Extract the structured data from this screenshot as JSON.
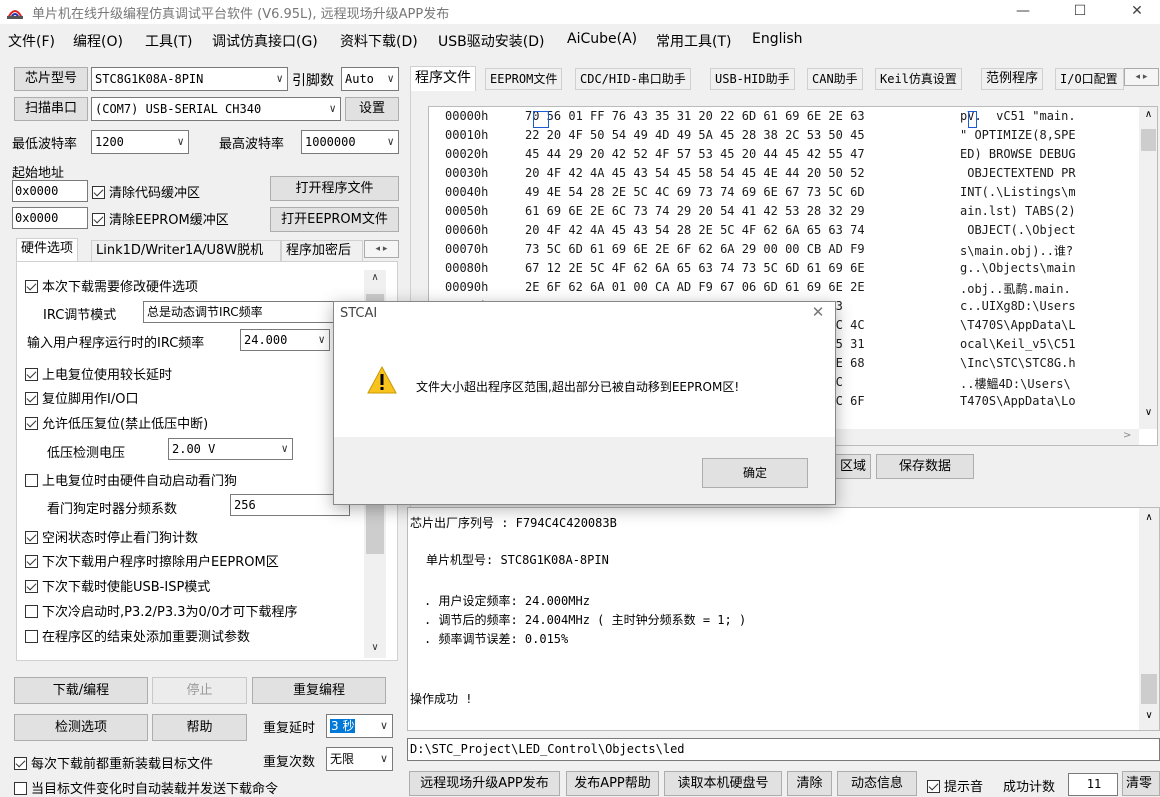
{
  "window": {
    "title": "单片机在线升级编程仿真调试平台软件 (V6.95L), 远程现场升级APP发布",
    "minimize": "—",
    "maximize": "☐",
    "close": "✕"
  },
  "menu": [
    "文件(F)",
    "编程(O)",
    "工具(T)",
    "调试仿真接口(G)",
    "资料下载(D)",
    "USB驱动安装(D)",
    "AiCube(A)",
    "常用工具(T)",
    "English"
  ],
  "left": {
    "chip_btn": "芯片型号",
    "chip_value": "STC8G1K08A-8PIN",
    "pins_label": "引脚数",
    "pins_value": "Auto",
    "scan_btn": "扫描串口",
    "port_value": "(COM7) USB-SERIAL CH340",
    "settings_btn": "设置",
    "min_baud_label": "最低波特率",
    "min_baud_value": "1200",
    "max_baud_label": "最高波特率",
    "max_baud_value": "1000000",
    "start_addr_label": "起始地址",
    "addr1": "0x0000",
    "clear_code_label": "清除代码缓冲区",
    "open_prog_btn": "打开程序文件",
    "addr2": "0x0000",
    "clear_eeprom_label": "清除EEPROM缓冲区",
    "open_eeprom_btn": "打开EEPROM文件",
    "tabs": [
      "硬件选项",
      "Link1D/Writer1A/U8W脱机",
      "程序加密后"
    ],
    "hw": {
      "opt1": "本次下载需要修改硬件选项",
      "irc_mode_label": "IRC调节模式",
      "irc_mode_value": "总是动态调节IRC频率",
      "irc_freq_label": "输入用户程序运行时的IRC频率",
      "irc_freq_value": "24.000",
      "irc_freq_unit": "M",
      "opt2": "上电复位使用较长延时",
      "opt3": "复位脚用作I/O口",
      "opt4": "允许低压复位(禁止低压中断)",
      "lv_label": "低压检测电压",
      "lv_value": "2.00 V",
      "opt5": "上电复位时由硬件自动启动看门狗",
      "wdt_label": "看门狗定时器分频系数",
      "wdt_value": "256",
      "opt6": "空闲状态时停止看门狗计数",
      "opt7": "下次下载用户程序时擦除用户EEPROM区",
      "opt8": "下次下载时使能USB-ISP模式",
      "opt9": "下次冷启动时,P3.2/P3.3为0/0才可下载程序",
      "opt10": "在程序区的结束处添加重要测试参数"
    },
    "download_btn": "下载/编程",
    "stop_btn": "停止",
    "reprogram_btn": "重复编程",
    "check_btn": "检测选项",
    "help_btn": "帮助",
    "repeat_delay_label": "重复延时",
    "repeat_delay_value": "3 秒",
    "reload_label": "每次下载前都重新装载目标文件",
    "repeat_count_label": "重复次数",
    "repeat_count_value": "无限",
    "auto_label": "当目标文件变化时自动装载并发送下载命令"
  },
  "right": {
    "tabs": [
      "程序文件",
      "EEPROM文件",
      "CDC/HID-串口助手",
      "USB-HID助手",
      "CAN助手",
      "Keil仿真设置",
      "范例程序",
      "I/O口配置"
    ],
    "hex_rows": [
      {
        "addr": "00000h",
        "bytes": "70 56 01 FF 76 43 35 31 20 22 6D 61 69 6E 2E 63",
        "ascii": "pV.  vC51 \"main."
      },
      {
        "addr": "00010h",
        "bytes": "22 20 4F 50 54 49 4D 49 5A 45 28 38 2C 53 50 45",
        "ascii": "\" OPTIMIZE(8,SPE"
      },
      {
        "addr": "00020h",
        "bytes": "45 44 29 20 42 52 4F 57 53 45 20 44 45 42 55 47",
        "ascii": "ED) BROWSE DEBUG"
      },
      {
        "addr": "00030h",
        "bytes": "20 4F 42 4A 45 43 54 45 58 54 45 4E 44 20 50 52",
        "ascii": " OBJECTEXTEND PR"
      },
      {
        "addr": "00040h",
        "bytes": "49 4E 54 28 2E 5C 4C 69 73 74 69 6E 67 73 5C 6D",
        "ascii": "INT(.\\Listings\\m"
      },
      {
        "addr": "00050h",
        "bytes": "61 69 6E 2E 6C 73 74 29 20 54 41 42 53 28 32 29",
        "ascii": "ain.lst) TABS(2)"
      },
      {
        "addr": "00060h",
        "bytes": "20 4F 42 4A 45 43 54 28 2E 5C 4F 62 6A 65 63 74",
        "ascii": " OBJECT(.\\Object"
      },
      {
        "addr": "00070h",
        "bytes": "73 5C 6D 61 69 6E 2E 6F 62 6A 29 00 00 CB AD F9",
        "ascii": "s\\main.obj)..谁?"
      },
      {
        "addr": "00080h",
        "bytes": "67 12 2E 5C 4F 62 6A 65 63 74 73 5C 6D 61 69 6E",
        "ascii": "g..\\Objects\\main"
      },
      {
        "addr": "00090h",
        "bytes": "2E 6F 62 6A 01 00 CA AD F9 67 06 6D 61 69 6E 2E",
        "ascii": ".obj..虱鹬.main."
      },
      {
        "addr": "000A0h",
        "bytes": "63 00 55 49 58 67 38 44 3A 5C 55 73 65 72 73",
        "ascii": "c..UIXg8D:\\Users"
      },
      {
        "addr": "000B0h",
        "bytes": "5C 54 34 37 30 53 5C 41 70 70 44 61 74 61 5C 4C",
        "ascii": "\\T470S\\AppData\\L"
      },
      {
        "addr": "000C0h",
        "bytes": "6F 63 61 6C 5C 4B 65 69 6C 5F 76 35 5C 43 35 31",
        "ascii": "ocal\\Keil_v5\\C51"
      },
      {
        "addr": "000D0h",
        "bytes": "5C 49 6E 63 5C 53 54 43 5C 53 54 43 38 47 2E 68",
        "ascii": "\\Inc\\STC\\STC8G.h"
      },
      {
        "addr": "000E0h",
        "bytes": "00 00 E8 A4 8D 34 44 3A 5C 55 73 65 72 73 5C",
        "ascii": "..樓鰮4D:\\Users\\"
      },
      {
        "addr": "000F0h",
        "bytes": "54 34 37 30 53 5C 41 70 70 44 61 74 61 5C 4C 6F",
        "ascii": "T470S\\AppData\\Lo"
      }
    ],
    "area_btn": "区域",
    "save_btn": "保存数据",
    "log": {
      "serial": "芯片出厂序列号 : F794C4C420083B",
      "model": "单片机型号: STC8G1K08A-8PIN",
      "f1": ". 用户设定频率: 24.000MHz",
      "f2": ". 调节后的频率: 24.004MHz ( 主时钟分频系数 = 1; )",
      "f3": ". 频率调节误差: 0.015%",
      "ok": "操作成功 !"
    },
    "path": "D:\\STC_Project\\LED_Control\\Objects\\led",
    "bottom_btns": [
      "远程现场升级APP发布",
      "发布APP帮助",
      "读取本机硬盘号",
      "清除",
      "动态信息"
    ],
    "beep_label": "提示音",
    "success_label": "成功计数",
    "success_value": "11",
    "clear_btn": "清零"
  },
  "dialog": {
    "title": "STCAI",
    "close": "✕",
    "message": "文件大小超出程序区范围,超出部分已被自动移到EEPROM区!",
    "ok_btn": "确定"
  },
  "colors": {
    "accent": "#0078d7",
    "warning": "#f8c31c"
  }
}
